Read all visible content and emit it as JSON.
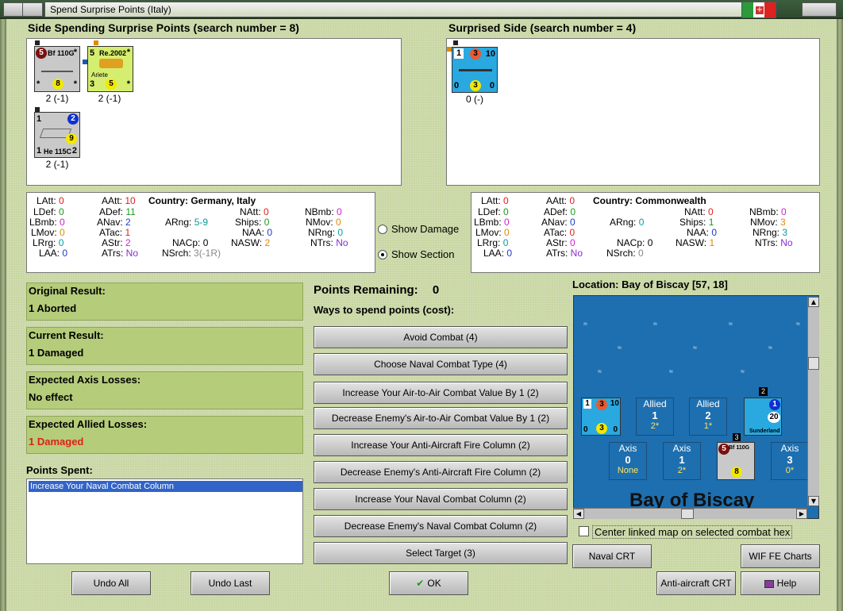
{
  "window": {
    "title": "Spend Surprise Points (Italy)"
  },
  "spending_side": {
    "header": "Side Spending Surprise Points (search number = 8)",
    "units": [
      {
        "name": "Bf 110G",
        "top_left": "5",
        "top_right": "*",
        "bottom_left": "*",
        "bottom_mid": "8",
        "bottom_right": "*",
        "caption": "2 (-1)"
      },
      {
        "name": "Re.2002",
        "top_left": "5",
        "top_right": "*",
        "sub": "Ariete",
        "bottom_left": "3",
        "bottom_mid": "5",
        "bottom_right": "*",
        "caption": "2 (-1)"
      },
      {
        "name": "He 115C",
        "top_left": "1",
        "top_right": "2",
        "bottom_left": "1",
        "bottom_mid": "9",
        "bottom_right": "2",
        "caption": "2 (-1)"
      }
    ]
  },
  "surprised_side": {
    "header": "Surprised Side (search number = 4)",
    "units": [
      {
        "top_left": "1",
        "top_mid": "3",
        "top_right": "10",
        "bottom_left": "0",
        "bottom_mid": "3",
        "bottom_right": "0",
        "caption": "0 (-)"
      }
    ]
  },
  "stats_left": {
    "country_label": "Country:",
    "country": "Germany, Italy",
    "rows": {
      "LAtt": "0",
      "AAtt": "10",
      "NAtt": "0",
      "NBmb": "0",
      "LDef": "0",
      "ADef": "11",
      "Ships": "0",
      "NMov": "0",
      "LBmb": "0",
      "ANav": "2",
      "ARng": "5-9",
      "NAA": "0",
      "NRng": "0",
      "LMov": "0",
      "ATac": "1",
      "NASW": "2",
      "NTrs": "No",
      "LRrg": "0",
      "AStr": "2",
      "NACp": "0",
      "LAA": "0",
      "ATrs": "No",
      "NSrch": "3(-1R)"
    }
  },
  "stats_right": {
    "country_label": "Country:",
    "country": "Commonwealth",
    "rows": {
      "LAtt": "0",
      "AAtt": "0",
      "NAtt": "0",
      "NBmb": "0",
      "LDef": "0",
      "ADef": "0",
      "Ships": "1",
      "NMov": "3",
      "LBmb": "0",
      "ANav": "0",
      "ARng": "0",
      "NAA": "0",
      "NRng": "3",
      "LMov": "0",
      "ATac": "0",
      "NASW": "1",
      "NTrs": "No",
      "LRrg": "0",
      "AStr": "0",
      "NACp": "0",
      "LAA": "0",
      "ATrs": "No",
      "NSrch": "0"
    }
  },
  "options": {
    "show_damage": "Show Damage",
    "show_section": "Show Section",
    "selected": "Show Section"
  },
  "results": {
    "original_label": "Original Result:",
    "original": "1 Aborted",
    "current_label": "Current Result:",
    "current": "1 Damaged",
    "axis_label": "Expected Axis Losses:",
    "axis": "No effect",
    "allied_label": "Expected Allied Losses:",
    "allied": "1 Damaged",
    "allied_color": "#e0201a"
  },
  "points_spent": {
    "label": "Points Spent:",
    "items": [
      "Increase Your Naval Combat Column"
    ]
  },
  "points_remaining": {
    "label": "Points Remaining:",
    "value": "0"
  },
  "ways_label": "Ways to spend points (cost):",
  "options_list": [
    "Avoid Combat (4)",
    "Choose Naval Combat Type (4)",
    "Increase Your Air-to-Air Combat Value By 1 (2)",
    "Decrease Enemy's Air-to-Air Combat Value By 1 (2)",
    "Increase Your Anti-Aircraft Fire Column (2)",
    "Decrease Enemy's Anti-Aircraft Fire Column (2)",
    "Increase Your Naval Combat Column (2)",
    "Decrease Enemy's Naval Combat Column (2)",
    "Select Target (3)"
  ],
  "location": {
    "label": "Location: Bay of Biscay [57, 18]",
    "map_name": "Bay of Biscay",
    "allied": [
      {
        "title": "Allied",
        "num": "1",
        "sub": "2*"
      },
      {
        "title": "Allied",
        "num": "2",
        "sub": "1*"
      }
    ],
    "axis": [
      {
        "title": "Axis",
        "num": "0",
        "sub": "None"
      },
      {
        "title": "Axis",
        "num": "1",
        "sub": "2*"
      },
      {
        "title": "Axis",
        "num": "3",
        "sub": "0*"
      }
    ],
    "ship_unit": {
      "top_left": "1",
      "top_mid": "3",
      "top_right": "10",
      "bottom_left": "0",
      "bottom_mid": "3",
      "bottom_right": "0"
    },
    "sunderland": {
      "name": "Sunderland",
      "badge": "2",
      "top_right": "1",
      "value": "20"
    },
    "bf_unit": {
      "name": "Bf 110G",
      "badge": "3",
      "top_left": "5",
      "value": "8"
    },
    "center_linked_label": "Center linked map on selected combat hex"
  },
  "buttons": {
    "undo_all": "Undo All",
    "undo_last": "Undo Last",
    "ok": "OK",
    "naval_crt": "Naval CRT",
    "wif_fe": "WIF FE Charts",
    "aa_crt": "Anti-aircraft CRT",
    "help": "Help"
  }
}
